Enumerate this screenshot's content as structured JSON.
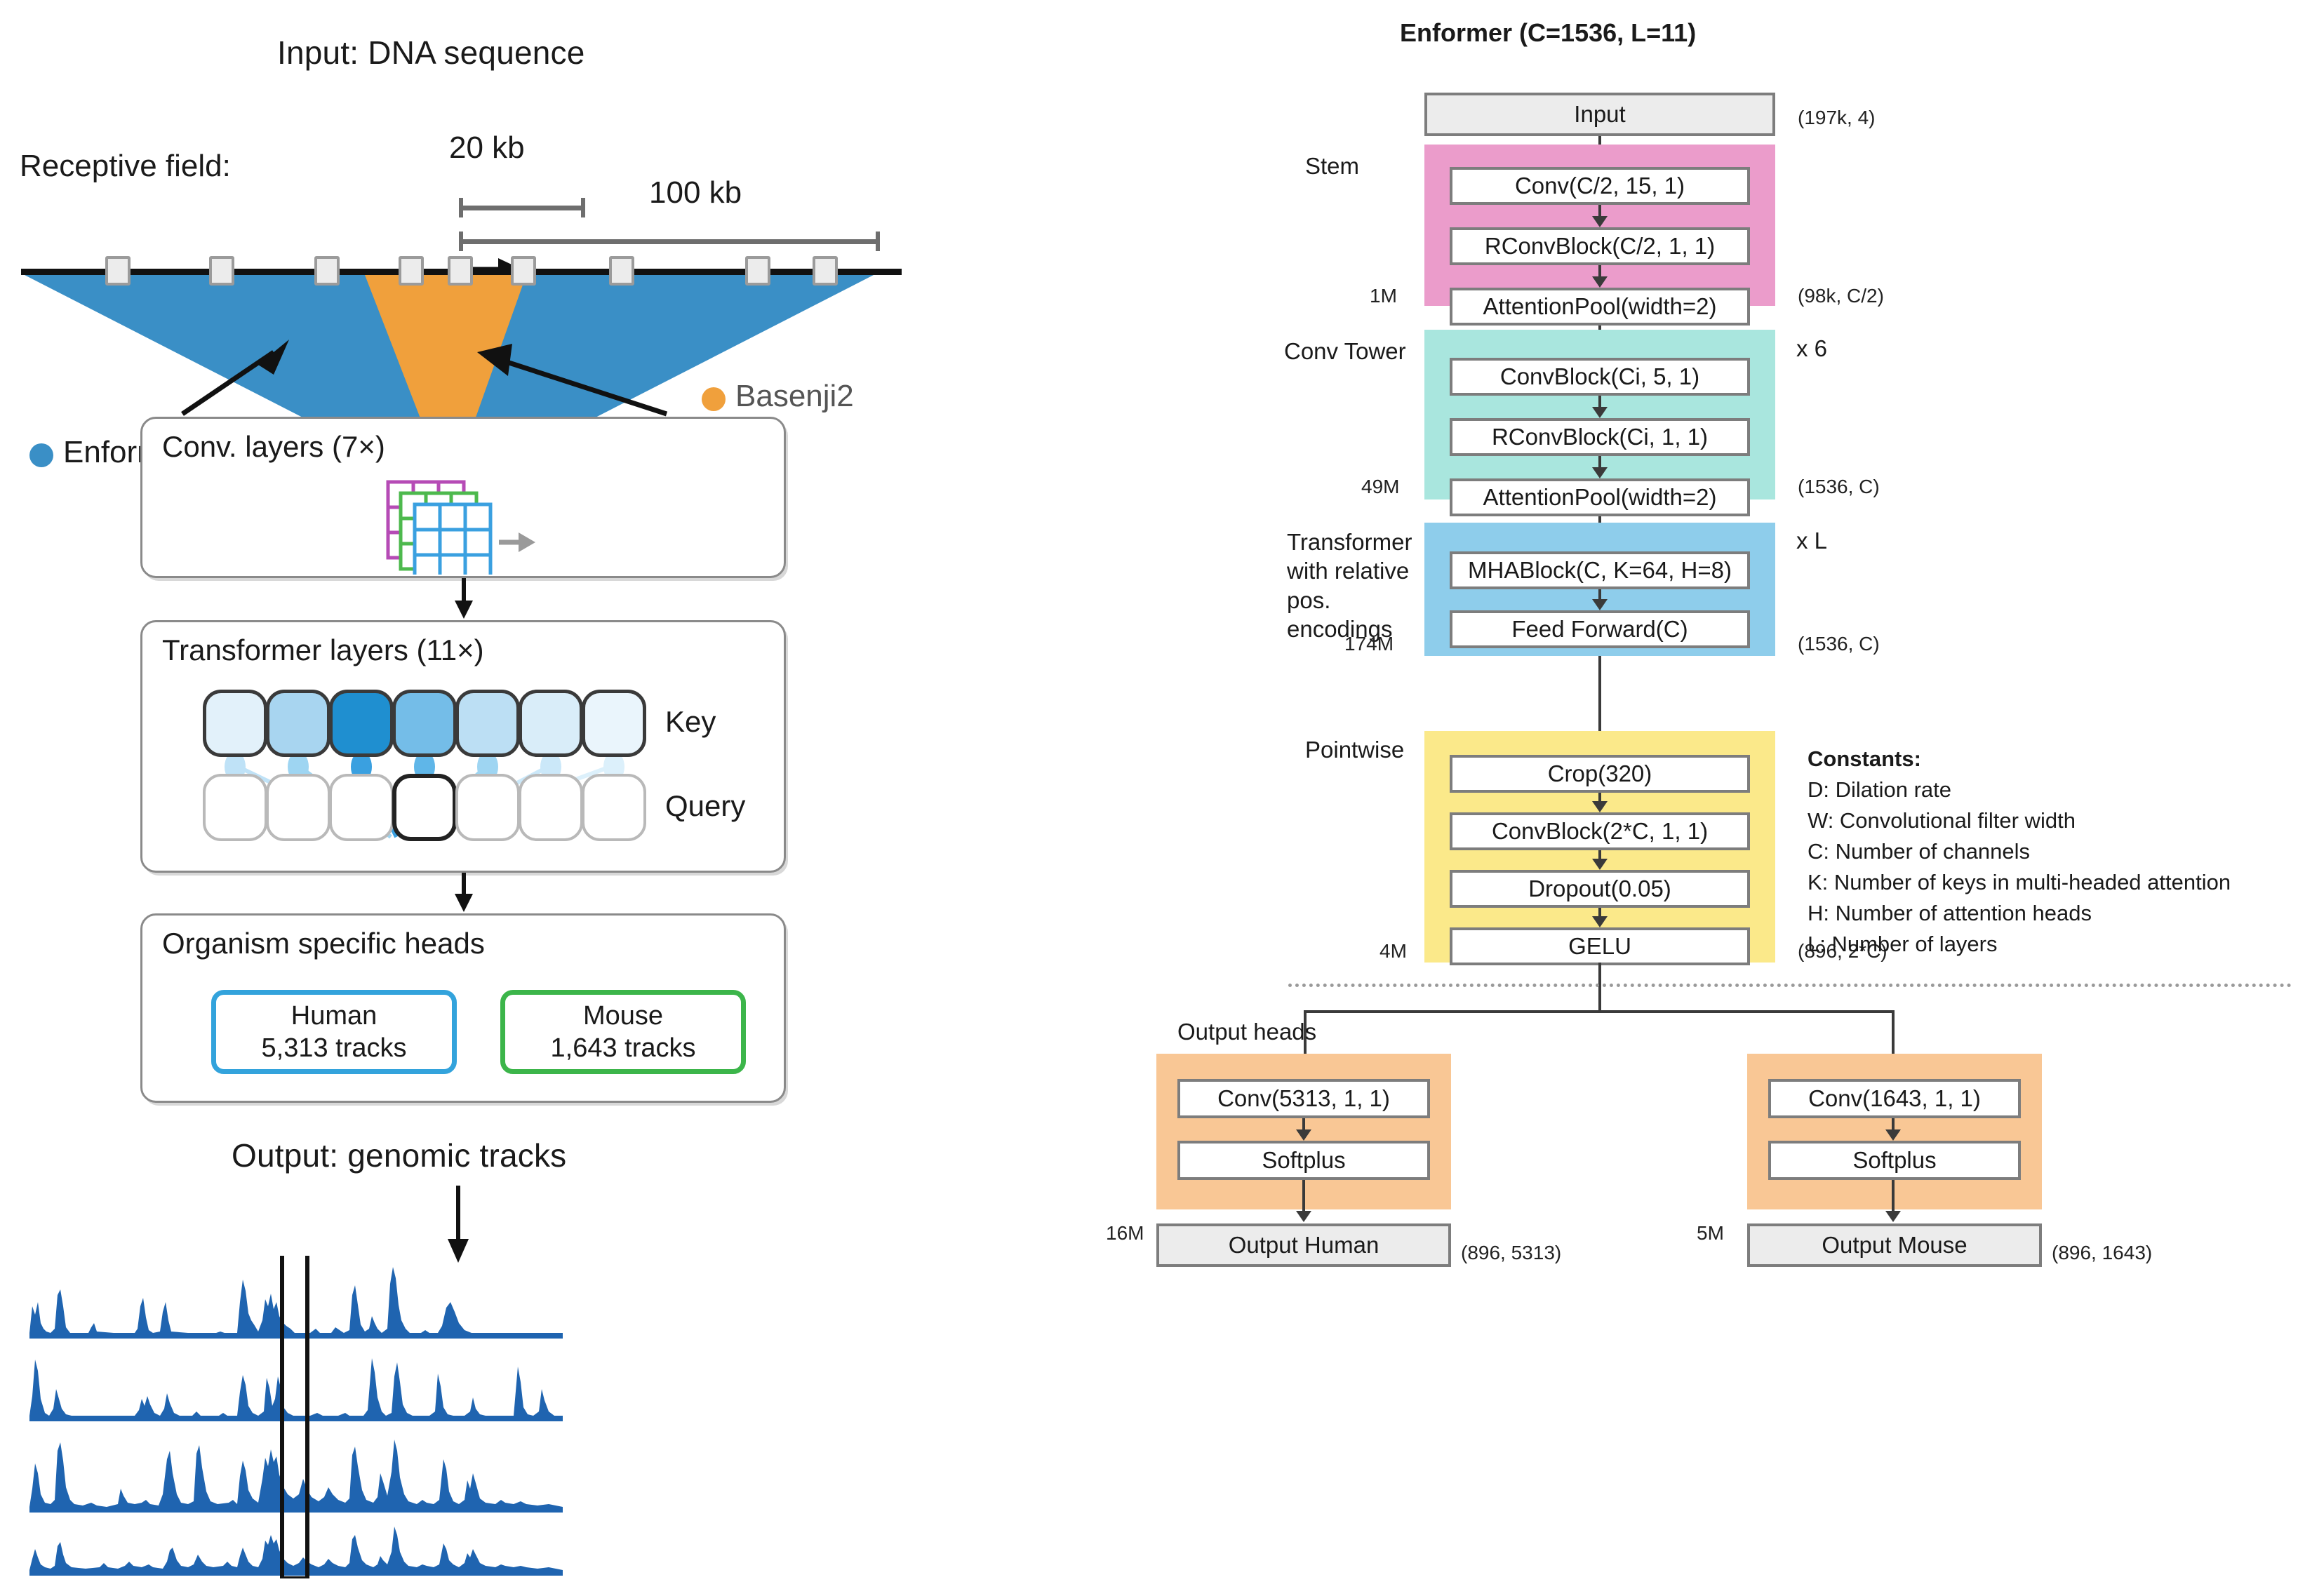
{
  "left": {
    "input_title": "Input: DNA sequence",
    "receptive_field_label": "Receptive field:",
    "scale_20kb": "20 kb",
    "scale_100kb": "100 kb",
    "legend": [
      {
        "label": "Enformer",
        "color": "#3a8fc6"
      },
      {
        "label": "Basenji2",
        "color": "#f0a03c"
      }
    ],
    "conv_card": {
      "title": "Conv. layers (7×)"
    },
    "transformer_card": {
      "title": "Transformer layers (11×)",
      "key_label": "Key",
      "query_label": "Query",
      "key_colors": [
        "#e2f1fa",
        "#a8d5f0",
        "#1f8fd0",
        "#74bde8",
        "#bcdff4",
        "#d9edf9",
        "#eaf5fc"
      ],
      "selected_query_index": 3
    },
    "heads_card": {
      "title": "Organism specific heads",
      "heads": [
        {
          "name": "Human",
          "tracks": "5,313 tracks",
          "color": "#33a3dc"
        },
        {
          "name": "Mouse",
          "tracks": "1,643 tracks",
          "color": "#3cb54a"
        }
      ]
    },
    "output_title": "Output: genomic tracks",
    "tracks_color": "#1f64b0"
  },
  "right": {
    "title": "Enformer (C=1536, L=11)",
    "input_node": "Input",
    "input_shape": "(197k, 4)",
    "groups": [
      {
        "name": "Stem",
        "color": "#eb9ccb",
        "nodes": [
          "Conv(C/2, 15, 1)",
          "RConvBlock(C/2, 1, 1)",
          "AttentionPool(width=2)"
        ],
        "params": "1M",
        "shape": "(98k, C/2)",
        "repeat": ""
      },
      {
        "name": "Conv Tower",
        "color": "#a9e6de",
        "nodes": [
          "ConvBlock(Ci, 5, 1)",
          "RConvBlock(Ci, 1, 1)",
          "AttentionPool(width=2)"
        ],
        "params": "49M",
        "shape": "(1536, C)",
        "repeat": "x 6"
      },
      {
        "name": "Transformer\nwith relative\npos. encodings",
        "color": "#8ecdeb",
        "nodes": [
          "MHABlock(C, K=64, H=8)",
          "Feed Forward(C)"
        ],
        "params": "174M",
        "shape": "(1536, C)",
        "repeat": "x L"
      },
      {
        "name": "Pointwise",
        "color": "#fbe98a",
        "nodes": [
          "Crop(320)",
          "ConvBlock(2*C, 1, 1)",
          "Dropout(0.05)",
          "GELU"
        ],
        "params": "4M",
        "shape": "(896, 2*C)",
        "repeat": ""
      }
    ],
    "output_heads_label": "Output heads",
    "heads": [
      {
        "color": "#f9c795",
        "nodes": [
          "Conv(5313, 1, 1)",
          "Softplus"
        ],
        "params": "16M",
        "output_node": "Output Human",
        "shape": "(896, 5313)"
      },
      {
        "color": "#f9c795",
        "nodes": [
          "Conv(1643, 1, 1)",
          "Softplus"
        ],
        "params": "5M",
        "output_node": "Output Mouse",
        "shape": "(896, 1643)"
      }
    ],
    "constants": {
      "title": "Constants:",
      "items": [
        "D: Dilation rate",
        "W: Convolutional filter width",
        "C: Number of channels",
        "K: Number of keys in multi-headed attention",
        "H: Number of attention heads",
        "L: Number of layers"
      ]
    }
  }
}
